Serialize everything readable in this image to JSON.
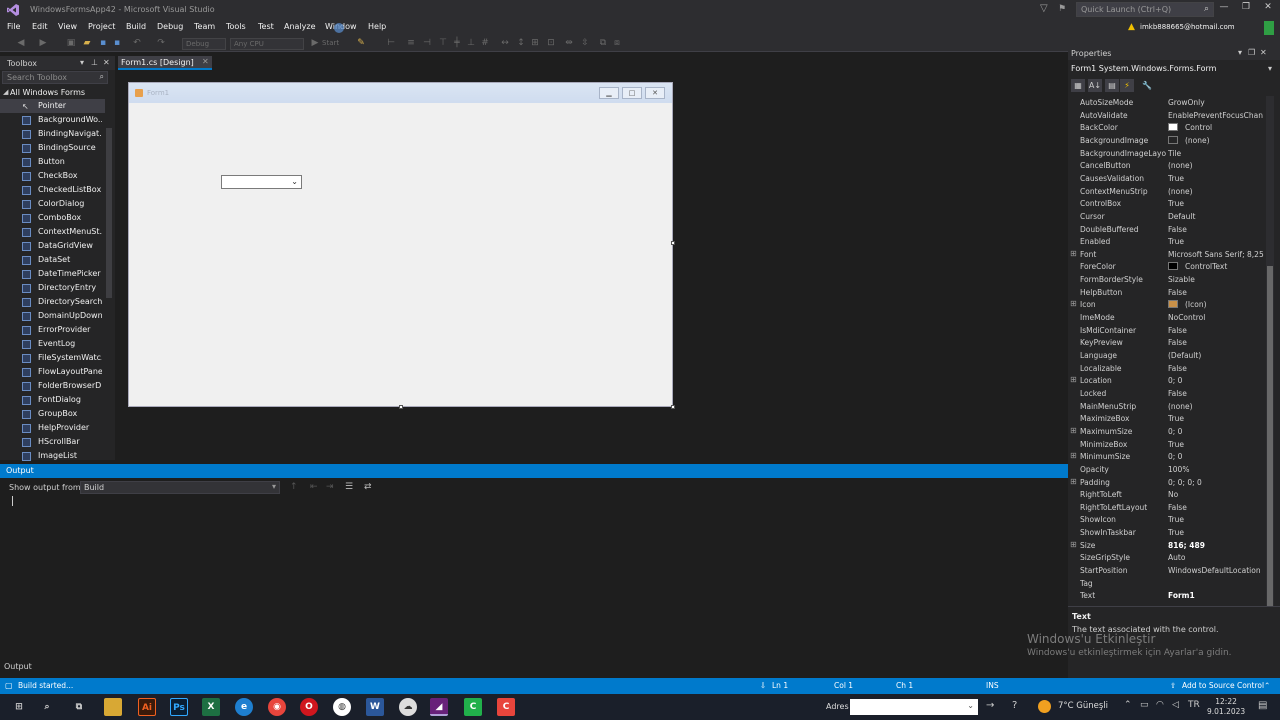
{
  "title": {
    "text": "WindowsFormsApp42 - Microsoft Visual Studio",
    "quick_launch_placeholder": "Quick Launch (Ctrl+Q)"
  },
  "menu": [
    "File",
    "Edit",
    "View",
    "Project",
    "Build",
    "Debug",
    "Team",
    "Tools",
    "Test",
    "Analyze",
    "Window",
    "Help"
  ],
  "user": "imkb888665@hotmail.com",
  "toolbar": {
    "config": "Debug",
    "platform": "Any CPU",
    "start": "Start"
  },
  "toolbox": {
    "title": "Toolbox",
    "search_placeholder": "Search Toolbox",
    "group": "All Windows Forms",
    "items": [
      "Pointer",
      "BackgroundWo...",
      "BindingNavigat...",
      "BindingSource",
      "Button",
      "CheckBox",
      "CheckedListBox",
      "ColorDialog",
      "ComboBox",
      "ContextMenuSt...",
      "DataGridView",
      "DataSet",
      "DateTimePicker",
      "DirectoryEntry",
      "DirectorySearch...",
      "DomainUpDown",
      "ErrorProvider",
      "EventLog",
      "FileSystemWatc...",
      "FlowLayoutPanel",
      "FolderBrowserD...",
      "FontDialog",
      "GroupBox",
      "HelpProvider",
      "HScrollBar",
      "ImageList"
    ]
  },
  "tab": {
    "label": "Form1.cs [Design]"
  },
  "form": {
    "caption": "Form1"
  },
  "output": {
    "title": "Output",
    "show_from_label": "Show output from:",
    "source": "Build",
    "bottom_tab": "Output"
  },
  "properties": {
    "title": "Properties",
    "object": "Form1  System.Windows.Forms.Form",
    "rows": [
      {
        "name": "AutoSizeMode",
        "value": "GrowOnly"
      },
      {
        "name": "AutoValidate",
        "value": "EnablePreventFocusChan"
      },
      {
        "name": "BackColor",
        "value": "Control",
        "swatch": "#ffffff"
      },
      {
        "name": "BackgroundImage",
        "value": "(none)",
        "swatch": "#252526"
      },
      {
        "name": "BackgroundImageLayout",
        "value": "Tile"
      },
      {
        "name": "CancelButton",
        "value": "(none)"
      },
      {
        "name": "CausesValidation",
        "value": "True"
      },
      {
        "name": "ContextMenuStrip",
        "value": "(none)"
      },
      {
        "name": "ControlBox",
        "value": "True"
      },
      {
        "name": "Cursor",
        "value": "Default"
      },
      {
        "name": "DoubleBuffered",
        "value": "False"
      },
      {
        "name": "Enabled",
        "value": "True"
      },
      {
        "name": "Font",
        "value": "Microsoft Sans Serif; 8,25pt",
        "expand": true
      },
      {
        "name": "ForeColor",
        "value": "ControlText",
        "swatch": "#000000"
      },
      {
        "name": "FormBorderStyle",
        "value": "Sizable"
      },
      {
        "name": "HelpButton",
        "value": "False"
      },
      {
        "name": "Icon",
        "value": "(Icon)",
        "expand": true,
        "swatch": "#c89048"
      },
      {
        "name": "ImeMode",
        "value": "NoControl"
      },
      {
        "name": "IsMdiContainer",
        "value": "False"
      },
      {
        "name": "KeyPreview",
        "value": "False"
      },
      {
        "name": "Language",
        "value": "(Default)"
      },
      {
        "name": "Localizable",
        "value": "False"
      },
      {
        "name": "Location",
        "value": "0; 0",
        "expand": true
      },
      {
        "name": "Locked",
        "value": "False"
      },
      {
        "name": "MainMenuStrip",
        "value": "(none)"
      },
      {
        "name": "MaximizeBox",
        "value": "True"
      },
      {
        "name": "MaximumSize",
        "value": "0; 0",
        "expand": true
      },
      {
        "name": "MinimizeBox",
        "value": "True"
      },
      {
        "name": "MinimumSize",
        "value": "0; 0",
        "expand": true
      },
      {
        "name": "Opacity",
        "value": "100%"
      },
      {
        "name": "Padding",
        "value": "0; 0; 0; 0",
        "expand": true
      },
      {
        "name": "RightToLeft",
        "value": "No"
      },
      {
        "name": "RightToLeftLayout",
        "value": "False"
      },
      {
        "name": "ShowIcon",
        "value": "True"
      },
      {
        "name": "ShowInTaskbar",
        "value": "True"
      },
      {
        "name": "Size",
        "value": "816; 489",
        "expand": true,
        "bold": true
      },
      {
        "name": "SizeGripStyle",
        "value": "Auto"
      },
      {
        "name": "StartPosition",
        "value": "WindowsDefaultLocation"
      },
      {
        "name": "Tag",
        "value": ""
      },
      {
        "name": "Text",
        "value": "Form1",
        "bold": true
      }
    ],
    "desc_name": "Text",
    "desc_text": "The text associated with the control."
  },
  "watermark": {
    "line1": "Windows'u Etkinleştir",
    "line2": "Windows'u etkinleştirmek için Ayarlar'a gidin."
  },
  "status": {
    "left": "Build started...",
    "ln": "Ln 1",
    "col": "Col 1",
    "ch": "Ch 1",
    "ins": "INS",
    "source_control": "Add to Source Control"
  },
  "taskbar": {
    "address_label": "Adres",
    "weather": "7°C  Güneşli",
    "time": "12:22",
    "date": "9.01.2023"
  },
  "colors": {
    "accent": "#007acc",
    "background": "#1e1e1e",
    "panel": "#252526"
  }
}
